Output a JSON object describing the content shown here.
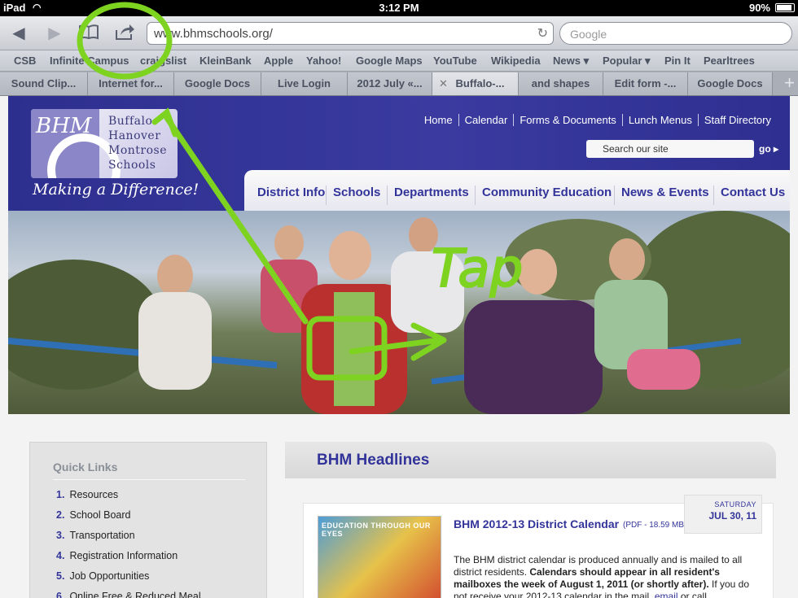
{
  "status_bar": {
    "carrier": "iPad",
    "time": "3:12 PM",
    "battery": "90%"
  },
  "toolbar": {
    "back_icon": "back-arrow-icon",
    "forward_icon": "forward-arrow-icon",
    "bookmarks_icon": "bookmarks-icon",
    "share_icon": "share-icon",
    "url": "www.bhmschools.org/",
    "search_placeholder": "Google"
  },
  "bookmarks": [
    "CSB",
    "Infinite Campus",
    "craigslist",
    "KleinBank",
    "Apple",
    "Yahoo!",
    "Google Maps",
    "YouTube",
    "Wikipedia",
    "News ▾",
    "Popular ▾",
    "Pin It",
    "Pearltrees"
  ],
  "tabs": [
    "Sound Clip...",
    "Internet for...",
    "Google Docs",
    "Live Login",
    "2012 July «...",
    "Buffalo-...",
    "and shapes",
    "Edit form -...",
    "Google Docs"
  ],
  "site": {
    "logo_initials": "BHM",
    "logo_lines": [
      "Buffalo",
      "Hanover",
      "Montrose",
      "Schools"
    ],
    "tagline": "Making a Difference!",
    "top_links": [
      "Home",
      "Calendar",
      "Forms & Documents",
      "Lunch Menus",
      "Staff Directory"
    ],
    "search_placeholder": "Search our site",
    "search_go": "go",
    "nav": [
      "District Info",
      "Schools",
      "Departments",
      "Community Education",
      "News & Events",
      "Contact Us"
    ]
  },
  "quick_links": {
    "title": "Quick Links",
    "items": [
      "Resources",
      "School Board",
      "Transportation",
      "Registration Information",
      "Job Opportunities",
      "Online Free & Reduced Meal"
    ]
  },
  "headlines": {
    "title": "BHM Headlines",
    "article": {
      "date_day": "SATURDAY",
      "date": "JUL 30, 11",
      "thumb_text": "EDUCATION THROUGH OUR EYES",
      "title": "BHM 2012-13 District Calendar",
      "meta": "(PDF - 18.59 MB)",
      "body_1": "The BHM district calendar is produced annually and is mailed to all district residents.",
      "body_bold": "Calendars should appear in all resident's mailboxes the week of August 1, 2011 (or shortly after).",
      "body_2": "If you do not receive your 2012-13 calendar in the mail,",
      "body_link": "email",
      "body_3": "or call"
    }
  },
  "annotation": {
    "text": "Tap",
    "color": "#7ed321"
  }
}
